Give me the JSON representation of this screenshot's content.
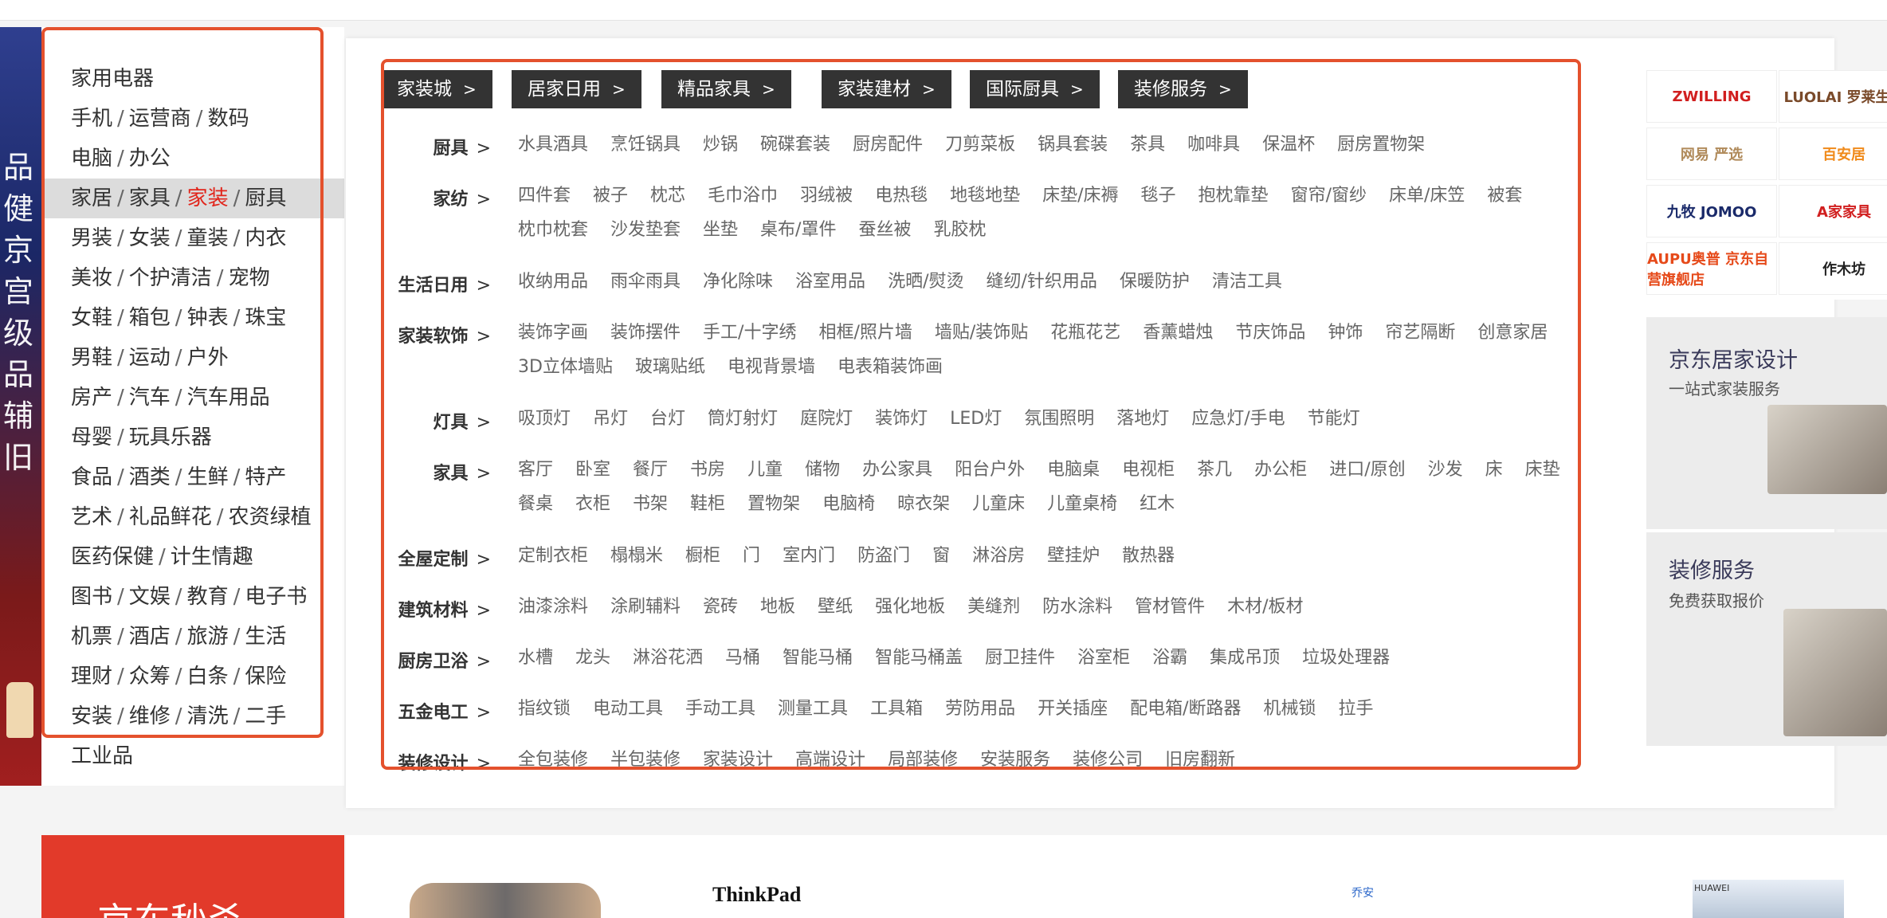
{
  "left_promo": {
    "glyphs": "品健京宫级品辅旧"
  },
  "sidebar": {
    "items": [
      {
        "segs": [
          "家用电器"
        ]
      },
      {
        "segs": [
          "手机",
          "运营商",
          "数码"
        ]
      },
      {
        "segs": [
          "电脑",
          "办公"
        ]
      },
      {
        "segs": [
          "家居",
          "家具",
          "家装",
          "厨具"
        ],
        "active": true,
        "highlight": 2
      },
      {
        "segs": [
          "男装",
          "女装",
          "童装",
          "内衣"
        ]
      },
      {
        "segs": [
          "美妆",
          "个护清洁",
          "宠物"
        ]
      },
      {
        "segs": [
          "女鞋",
          "箱包",
          "钟表",
          "珠宝"
        ]
      },
      {
        "segs": [
          "男鞋",
          "运动",
          "户外"
        ]
      },
      {
        "segs": [
          "房产",
          "汽车",
          "汽车用品"
        ]
      },
      {
        "segs": [
          "母婴",
          "玩具乐器"
        ]
      },
      {
        "segs": [
          "食品",
          "酒类",
          "生鲜",
          "特产"
        ]
      },
      {
        "segs": [
          "艺术",
          "礼品鲜花",
          "农资绿植"
        ]
      },
      {
        "segs": [
          "医药保健",
          "计生情趣"
        ]
      },
      {
        "segs": [
          "图书",
          "文娱",
          "教育",
          "电子书"
        ]
      },
      {
        "segs": [
          "机票",
          "酒店",
          "旅游",
          "生活"
        ]
      },
      {
        "segs": [
          "理财",
          "众筹",
          "白条",
          "保险"
        ]
      },
      {
        "segs": [
          "安装",
          "维修",
          "清洗",
          "二手"
        ]
      },
      {
        "segs": [
          "工业品"
        ]
      }
    ],
    "separator": "/"
  },
  "mega": {
    "chevron": ">",
    "tabs": [
      "家装城",
      "居家日用",
      "精品家具",
      "家装建材",
      "国际厨具",
      "装修服务"
    ],
    "rows": [
      {
        "label": "厨具",
        "links": [
          "水具酒具",
          "烹饪锅具",
          "炒锅",
          "碗碟套装",
          "厨房配件",
          "刀剪菜板",
          "锅具套装",
          "茶具",
          "咖啡具",
          "保温杯",
          "厨房置物架"
        ]
      },
      {
        "label": "家纺",
        "links": [
          "四件套",
          "被子",
          "枕芯",
          "毛巾浴巾",
          "羽绒被",
          "电热毯",
          "地毯地垫",
          "床垫/床褥",
          "毯子",
          "抱枕靠垫",
          "窗帘/窗纱",
          "床单/床笠",
          "被套",
          "枕巾枕套",
          "沙发垫套",
          "坐垫",
          "桌布/罩件",
          "蚕丝被",
          "乳胶枕"
        ]
      },
      {
        "label": "生活日用",
        "links": [
          "收纳用品",
          "雨伞雨具",
          "净化除味",
          "浴室用品",
          "洗晒/熨烫",
          "缝纫/针织用品",
          "保暖防护",
          "清洁工具"
        ]
      },
      {
        "label": "家装软饰",
        "links": [
          "装饰字画",
          "装饰摆件",
          "手工/十字绣",
          "相框/照片墙",
          "墙贴/装饰贴",
          "花瓶花艺",
          "香薰蜡烛",
          "节庆饰品",
          "钟饰",
          "帘艺隔断",
          "创意家居",
          "3D立体墙贴",
          "玻璃贴纸",
          "电视背景墙",
          "电表箱装饰画"
        ]
      },
      {
        "label": "灯具",
        "links": [
          "吸顶灯",
          "吊灯",
          "台灯",
          "筒灯射灯",
          "庭院灯",
          "装饰灯",
          "LED灯",
          "氛围照明",
          "落地灯",
          "应急灯/手电",
          "节能灯"
        ]
      },
      {
        "label": "家具",
        "links": [
          "客厅",
          "卧室",
          "餐厅",
          "书房",
          "儿童",
          "储物",
          "办公家具",
          "阳台户外",
          "电脑桌",
          "电视柜",
          "茶几",
          "办公柜",
          "进口/原创",
          "沙发",
          "床",
          "床垫",
          "餐桌",
          "衣柜",
          "书架",
          "鞋柜",
          "置物架",
          "电脑椅",
          "晾衣架",
          "儿童床",
          "儿童桌椅",
          "红木"
        ]
      },
      {
        "label": "全屋定制",
        "links": [
          "定制衣柜",
          "榻榻米",
          "橱柜",
          "门",
          "室内门",
          "防盗门",
          "窗",
          "淋浴房",
          "壁挂炉",
          "散热器"
        ]
      },
      {
        "label": "建筑材料",
        "links": [
          "油漆涂料",
          "涂刷辅料",
          "瓷砖",
          "地板",
          "壁纸",
          "强化地板",
          "美缝剂",
          "防水涂料",
          "管材管件",
          "木材/板材"
        ]
      },
      {
        "label": "厨房卫浴",
        "links": [
          "水槽",
          "龙头",
          "淋浴花洒",
          "马桶",
          "智能马桶",
          "智能马桶盖",
          "厨卫挂件",
          "浴室柜",
          "浴霸",
          "集成吊顶",
          "垃圾处理器"
        ]
      },
      {
        "label": "五金电工",
        "links": [
          "指纹锁",
          "电动工具",
          "手动工具",
          "测量工具",
          "工具箱",
          "劳防用品",
          "开关插座",
          "配电箱/断路器",
          "机械锁",
          "拉手"
        ]
      },
      {
        "label": "装修设计",
        "links": [
          "全包装修",
          "半包装修",
          "家装设计",
          "高端设计",
          "局部装修",
          "安装服务",
          "装修公司",
          "旧房翻新"
        ]
      }
    ]
  },
  "brands": [
    {
      "name": "双立人",
      "label": "ZWILLING",
      "color": "#d11f1f"
    },
    {
      "name": "LUOLAI",
      "label": "LUOLAI 罗莱生活",
      "color": "#7a4a2a"
    },
    {
      "name": "网易严选",
      "label": "网易 严选",
      "color": "#b08a5a"
    },
    {
      "name": "百安居",
      "label": "百安居",
      "color": "#f08a1a"
    },
    {
      "name": "九牧",
      "label": "九牧 JOMOO",
      "color": "#1a2a6a"
    },
    {
      "name": "A家家具",
      "label": "A家家具",
      "color": "#d11f1f"
    },
    {
      "name": "AUPU奥普",
      "label": "AUPU奥普 京东自营旗舰店",
      "color": "#e64a1a"
    },
    {
      "name": "作木坊",
      "label": "作木坊",
      "color": "#222"
    }
  ],
  "promos": [
    {
      "title": "京东居家设计",
      "sub": "一站式家装服务"
    },
    {
      "title": "装修服务",
      "sub": "免费获取报价"
    }
  ],
  "bottom": {
    "seckill": "京东秒杀",
    "thinkpad": "ThinkPad",
    "brand2": "乔安",
    "laptop_brand": "HUAWEI"
  }
}
